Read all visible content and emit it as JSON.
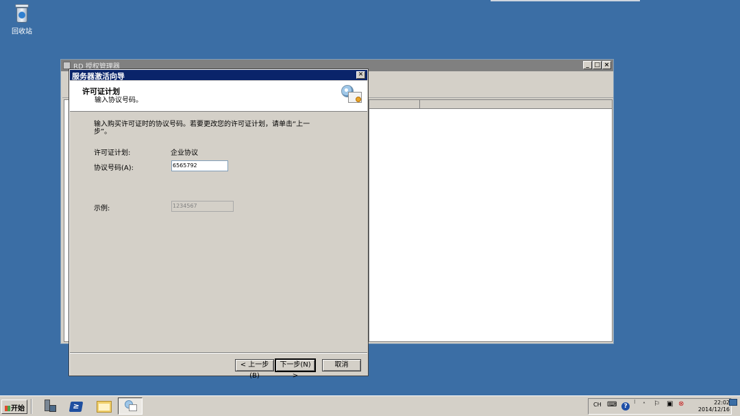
{
  "desktop": {
    "recycle_bin_label": "回收站"
  },
  "background_window": {
    "title": "RD 授权管理器"
  },
  "wizard": {
    "title": "服务器激活向导",
    "close_glyph": "✕",
    "header": {
      "title": "许可证计划",
      "subtitle": "输入协议号码。"
    },
    "instruction": "输入购买许可证时的协议号码。若要更改您的许可证计划，请单击“上一步”。",
    "license_plan_label": "许可证计划:",
    "license_plan_value": "企业协议",
    "agreement_number_label": "协议号码(A):",
    "agreement_number_value": "6565792",
    "example_label": "示例:",
    "example_value": "1234567",
    "buttons": {
      "back": "< 上一步(B)",
      "next": "下一步(N) >",
      "cancel": "取消"
    }
  },
  "taskbar": {
    "start_label": "开始",
    "tray": {
      "language": "CH",
      "time": "22:02",
      "date": "2014/12/16"
    }
  }
}
